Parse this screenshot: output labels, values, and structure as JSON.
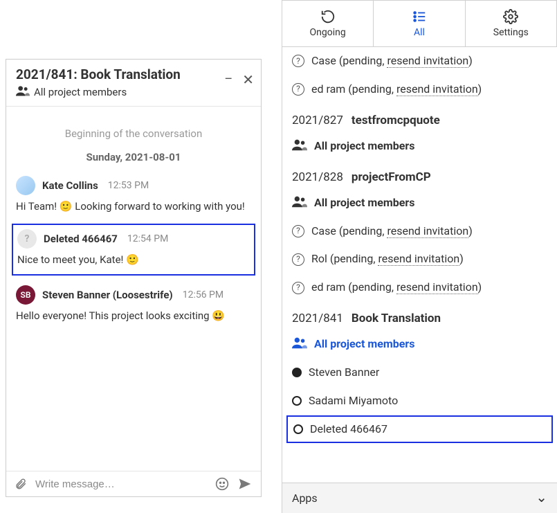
{
  "chat": {
    "title": "2021/841: Book Translation",
    "subtitle": "All project members",
    "beginning": "Beginning of the conversation",
    "date_divider": "Sunday, 2021-08-01",
    "messages": [
      {
        "avatar_kind": "kate",
        "avatar_text": "",
        "sender": "Kate Collins",
        "time": "12:53 PM",
        "body": "Hi Team! 🙂 Looking forward to working with you!",
        "highlighted": false
      },
      {
        "avatar_kind": "deleted",
        "avatar_text": "?",
        "sender": "Deleted 466467",
        "time": "12:54 PM",
        "body": "Nice to meet you, Kate! 🙂",
        "highlighted": true
      },
      {
        "avatar_kind": "sb",
        "avatar_text": "SB",
        "sender": "Steven Banner (Loosestrife)",
        "time": "12:56 PM",
        "body": "Hello everyone! This project looks exciting 😃",
        "highlighted": false
      }
    ],
    "input_placeholder": "Write message…"
  },
  "tabs": {
    "ongoing": "Ongoing",
    "all": "All",
    "settings": "Settings"
  },
  "sidebar": {
    "top_pending": [
      {
        "name": "Case",
        "pending_prefix": " (pending, ",
        "resend": "resend invitation",
        "suffix": ")"
      },
      {
        "name": "ed ram",
        "pending_prefix": " (pending, ",
        "resend": "resend invitation",
        "suffix": ")"
      }
    ],
    "projects": [
      {
        "code": "2021/827",
        "name": "testfromcpquote",
        "group_label": "All project members",
        "group_is_link": false,
        "members": []
      },
      {
        "code": "2021/828",
        "name": "projectFromCP",
        "group_label": "All project members",
        "group_is_link": false,
        "members": [
          {
            "type": "pending",
            "name": "Case",
            "resend": "resend invitation"
          },
          {
            "type": "pending",
            "name": "Rol",
            "resend": "resend invitation"
          },
          {
            "type": "pending",
            "name": "ed ram",
            "resend": "resend invitation"
          }
        ]
      },
      {
        "code": "2021/841",
        "name": "Book Translation",
        "group_label": "All project members",
        "group_is_link": true,
        "members": [
          {
            "type": "status",
            "status": "filled",
            "name": "Steven Banner",
            "highlighted": false
          },
          {
            "type": "status",
            "status": "empty",
            "name": "Sadami Miyamoto",
            "highlighted": false
          },
          {
            "type": "status",
            "status": "empty",
            "name": "Deleted 466467",
            "highlighted": true
          }
        ]
      }
    ],
    "apps_label": "Apps"
  }
}
